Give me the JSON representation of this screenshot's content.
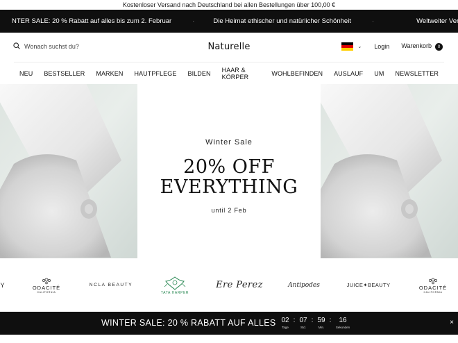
{
  "topbar": {
    "text": "Kostenloser Versand nach Deutschland bei allen Bestellungen über 100,00 €"
  },
  "promo": {
    "item1": "NTER SALE: 20 % Rabatt auf alles bis zum 2. Februar",
    "sep": "·",
    "item2": "Die Heimat ethischer und natürlicher Schönheit",
    "item3": "Weltweiter Versand"
  },
  "header": {
    "search_placeholder": "Wonach suchst du?",
    "logo": "Naturelle",
    "login": "Login",
    "cart_label": "Warenkorb",
    "cart_count": "0",
    "flag_colors": [
      "#000000",
      "#dd0000",
      "#ffce00"
    ]
  },
  "nav": {
    "items": [
      "NEU",
      "BESTSELLER",
      "MARKEN",
      "HAUTPFLEGE",
      "BILDEN",
      "HAAR & KÖRPER",
      "WOHLBEFINDEN",
      "AUSLAUF",
      "UM",
      "NEWSLETTER"
    ]
  },
  "hero": {
    "subtitle": "Winter Sale",
    "headline_1": "20% OFF",
    "headline_2": "EVERYTHING",
    "until": "until 2 Feb"
  },
  "brands": {
    "items": [
      "Y",
      "ODACITÉ",
      "NCLA BEAUTY",
      "TATA HARPER",
      "Ere Perez",
      "Antipodes",
      "JUICE✦BEAUTY",
      "ODACITÉ"
    ],
    "odacite_sub": "CALIFORNIA"
  },
  "countdown": {
    "title": "WINTER SALE: 20 % RABATT AUF ALLES",
    "days": "02",
    "days_label": "Tage",
    "hours": "07",
    "hours_label": "Std.",
    "minutes": "59",
    "minutes_label": "Min.",
    "seconds": "16",
    "seconds_label": "Sekunden",
    "sep": ":",
    "close": "×"
  },
  "colors": {
    "dark": "#0f0f0f",
    "tata_green": "#2e8b57"
  }
}
